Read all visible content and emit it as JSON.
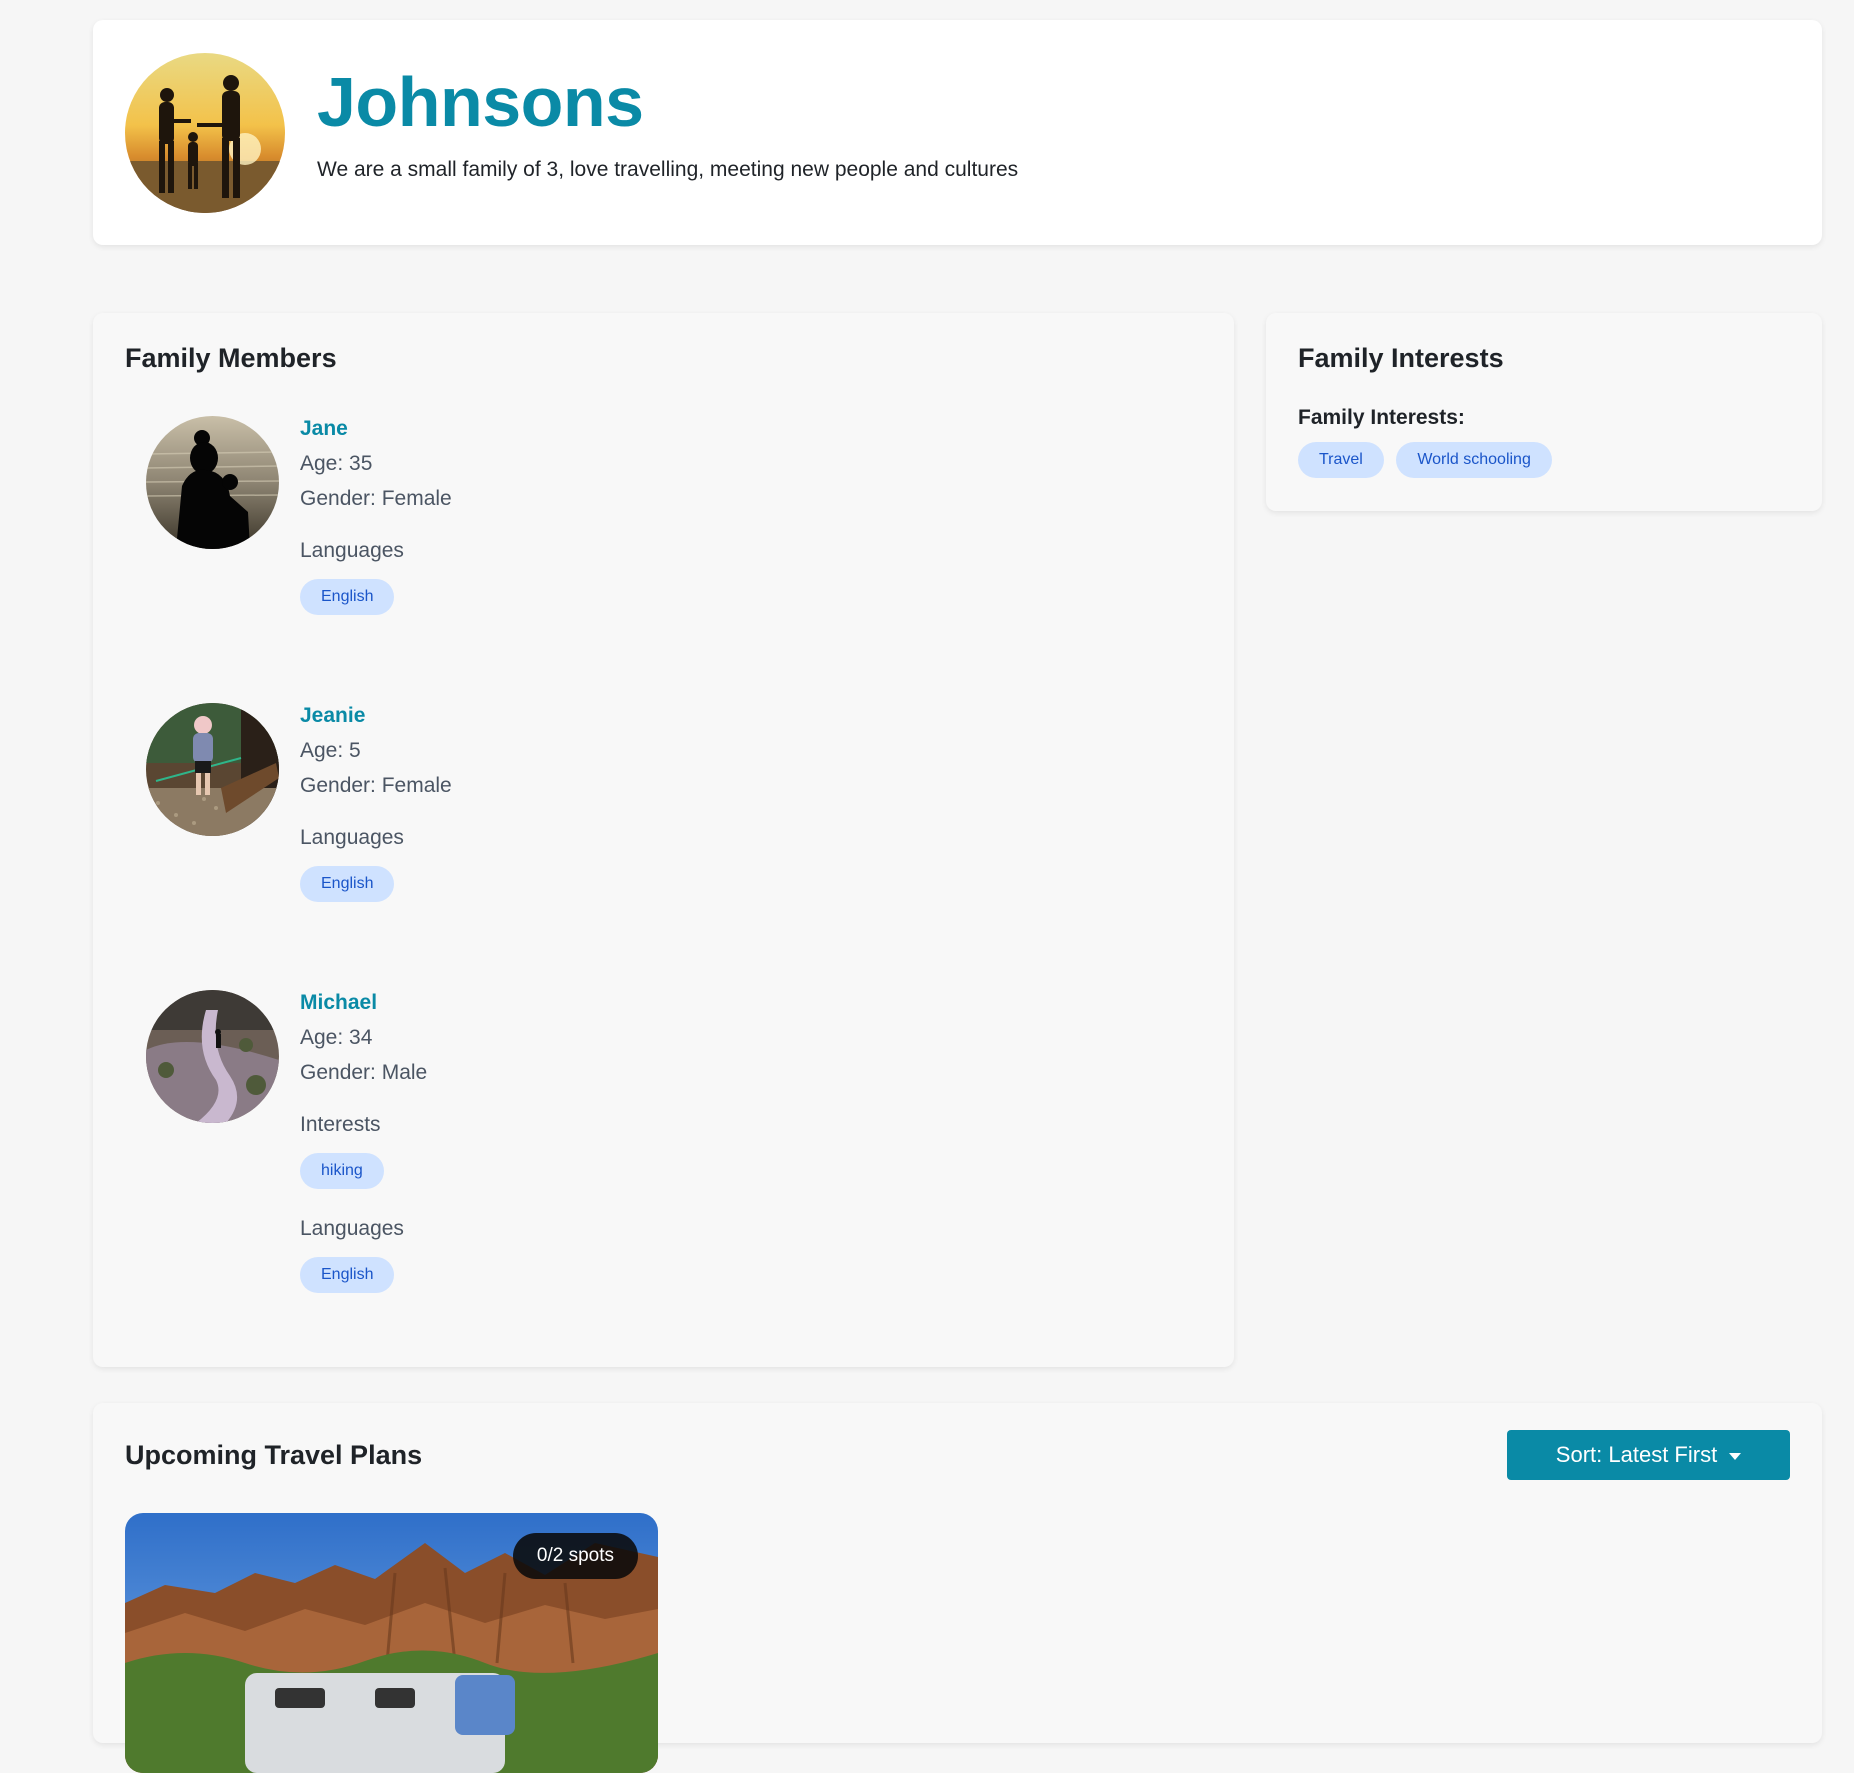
{
  "header": {
    "family_name": "Johnsons",
    "description": "We are a small family of 3, love travelling, meeting new people and cultures"
  },
  "members_section": {
    "title": "Family Members",
    "members": [
      {
        "name": "Jane",
        "age": "Age: 35",
        "gender": "Gender: Female",
        "languages_label": "Languages",
        "languages": [
          "English"
        ]
      },
      {
        "name": "Jeanie",
        "age": "Age: 5",
        "gender": "Gender: Female",
        "languages_label": "Languages",
        "languages": [
          "English"
        ]
      },
      {
        "name": "Michael",
        "age": "Age: 34",
        "gender": "Gender: Male",
        "interests_label": "Interests",
        "interests": [
          "hiking"
        ],
        "languages_label": "Languages",
        "languages": [
          "English"
        ]
      }
    ]
  },
  "interests_section": {
    "title": "Family Interests",
    "label": "Family Interests:",
    "chips": [
      "Travel",
      "World schooling"
    ]
  },
  "travel_section": {
    "title": "Upcoming Travel Plans",
    "sort_label": "Sort: Latest First",
    "plans": [
      {
        "spots": "0/2 spots"
      }
    ]
  },
  "colors": {
    "accent": "#0a8aa6",
    "chip_bg": "#cfe2ff",
    "chip_text": "#1a55c9"
  }
}
